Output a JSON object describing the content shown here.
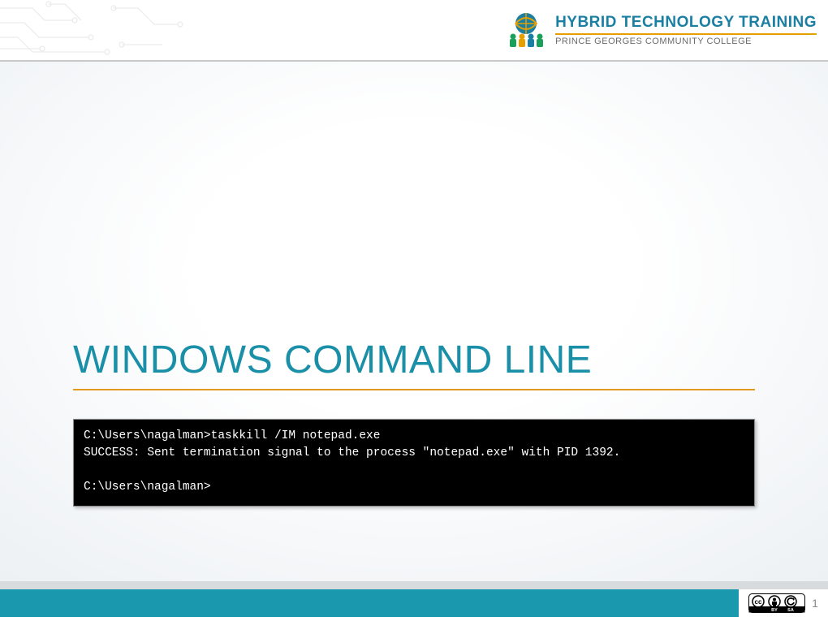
{
  "header": {
    "logo_main": "HYBRID TECHNOLOGY TRAINING",
    "logo_sub": "PRINCE GEORGES COMMUNITY COLLEGE"
  },
  "slide": {
    "title": "WINDOWS COMMAND LINE",
    "terminal": {
      "line1": "C:\\Users\\nagalman>taskkill /IM notepad.exe",
      "line2": "SUCCESS: Sent termination signal to the process \"notepad.exe\" with PID 1392.",
      "line3": "",
      "line4": "C:\\Users\\nagalman>"
    }
  },
  "footer": {
    "cc_label": "CC BY SA",
    "page_number": "1"
  }
}
